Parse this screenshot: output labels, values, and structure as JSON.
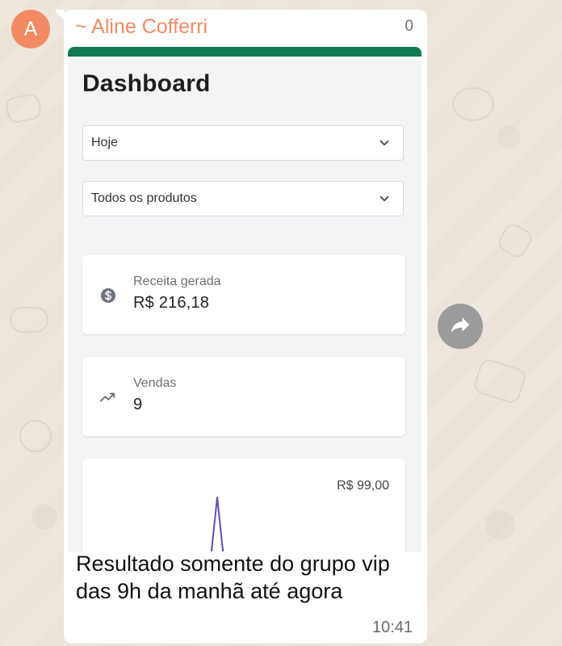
{
  "chat": {
    "avatar_letter": "A",
    "sender_name": "~ Aline Cofferri",
    "corner_fragment": "0",
    "caption": "Resultado somente do grupo vip das 9h da manhã até agora",
    "time": "10:41"
  },
  "dashboard": {
    "title": "Dashboard",
    "filters": {
      "period": "Hoje",
      "product": "Todos os produtos"
    },
    "revenue_card": {
      "label": "Receita gerada",
      "value": "R$  216,18"
    },
    "sales_card": {
      "label": "Vendas",
      "value": "9"
    },
    "chart_card": {
      "top_value_label": "R$  99,00"
    }
  },
  "chart_data": {
    "type": "line",
    "title": "",
    "xlabel": "",
    "ylabel": "",
    "series": [
      {
        "values": [
          0,
          99,
          0
        ]
      }
    ],
    "visible_top_label": "R$  99,00",
    "legend": "none",
    "grid": false
  },
  "colors": {
    "header_bar": "#117a50",
    "sender_name": "#f28b63",
    "avatar": "#f28b63",
    "chart_line": "#5850b8",
    "forward_button": "#9b9b9b"
  },
  "icons": {
    "dropdown": "chevron-down-icon",
    "revenue": "dollar-icon",
    "sales": "trending-up-icon",
    "forward": "forward-icon"
  }
}
